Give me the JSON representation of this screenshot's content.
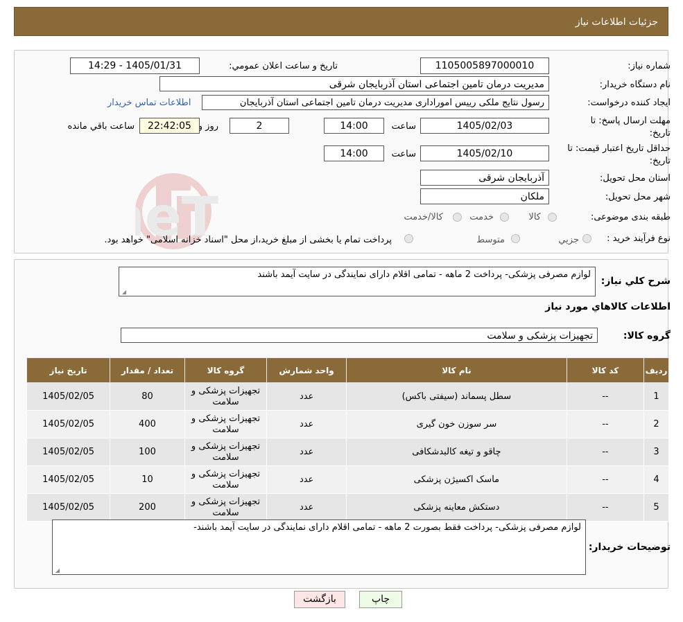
{
  "header": {
    "title": "جزئیات اطلاعات نیاز"
  },
  "fields": {
    "need_number_label": "شماره نیاز:",
    "need_number": "1105005897000010",
    "announce_label": "تاریخ و ساعت اعلان عمومي:",
    "announce_value": "1405/01/31 - 14:29",
    "buyer_label": "نام دستگاه خريدار:",
    "buyer_value": "مديريت درمان تامين اجتماعی استان آذربايجان شرقی",
    "creator_label": "ايجاد کننده درخواست:",
    "creator_value": "رسول نتايج ملكی رييس امورادارى مديريت درمان تامين اجتماعی استان آذربايجان",
    "contact_link": "اطلاعات تماس خريدار",
    "deadline_label_1": "مهلت ارسال پاسخ: تا",
    "deadline_label_2": "تاريخ:",
    "deadline_date": "1405/02/03",
    "time_label": "ساعت",
    "deadline_time": "14:00",
    "days_value": "2",
    "days_label": "روز و",
    "remaining_time": "22:42:05",
    "remaining_label": "ساعت باقي مانده",
    "validity_label_1": "حداقل تاريخ اعتبار قيمت: تا",
    "validity_label_2": "تاريخ:",
    "validity_date": "1405/02/10",
    "validity_time": "14:00",
    "province_label": "استان محل تحويل:",
    "province_value": "آذربايجان شرقی",
    "city_label": "شهر محل تحويل:",
    "city_value": "ملكان",
    "category_label": "طبقه بندی موضوعی:",
    "category_options": [
      "کالا",
      "خدمت",
      "کالا/خدمت"
    ],
    "process_label": "نوع فرآيند خريد :",
    "process_options": [
      "جزيي",
      "متوسط"
    ],
    "process_note": "پرداخت تمام يا بخشی از مبلغ خريد،از محل \"اسناد خزانه اسلامی\" خواهد بود."
  },
  "summary": {
    "label": "شرح کلي نياز:",
    "value": "لوازم مصرفی پزشکی- پرداخت 2 ماهه - تمامی اقلام دارای نمایندگی در سایت آیمد باشند",
    "goods_info_title": "اطلاعات کالاهاي مورد نياز",
    "group_label": "گروه کالا:",
    "group_value": "تجهيزات پزشکی و سلامت"
  },
  "table": {
    "headers": [
      "رديف",
      "کد کالا",
      "نام کالا",
      "واحد شمارش",
      "گروه کالا",
      "تعداد / مقدار",
      "تاريخ نياز"
    ],
    "rows": [
      [
        "1",
        "--",
        "سطل پسماند (سیفتی باکس)",
        "عدد",
        "تجهيزات پزشکی و سلامت",
        "80",
        "1405/02/05"
      ],
      [
        "2",
        "--",
        "سر سوزن خون گیری",
        "عدد",
        "تجهيزات پزشکی و سلامت",
        "400",
        "1405/02/05"
      ],
      [
        "3",
        "--",
        "چاقو و تیغه کالبدشکافی",
        "عدد",
        "تجهيزات پزشکی و سلامت",
        "100",
        "1405/02/05"
      ],
      [
        "4",
        "--",
        "ماسک اکسیژن پزشکی",
        "عدد",
        "تجهيزات پزشکی و سلامت",
        "10",
        "1405/02/05"
      ],
      [
        "5",
        "--",
        "دستکش معاینه پزشکی",
        "عدد",
        "تجهيزات پزشکی و سلامت",
        "200",
        "1405/02/05"
      ]
    ]
  },
  "buyer_notes": {
    "label": "توضيحات خريدار:",
    "value": "لوازم مصرفی پزشکی- پرداخت فقط بصورت 2 ماهه - تمامی اقلام دارای نمایندگی در سایت آیمد باشند-"
  },
  "buttons": {
    "print": "چاپ",
    "back": "بازگشت"
  },
  "watermark_text": "AriaTender.neT",
  "colors": {
    "header_bg": "#8b6a3a",
    "link": "#2f5fbf",
    "print_bg": "#eefbe6",
    "back_bg": "#fde6e6"
  }
}
